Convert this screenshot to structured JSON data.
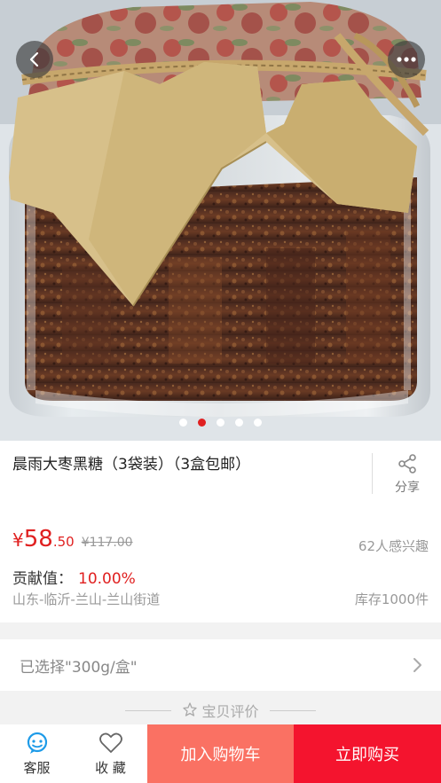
{
  "product": {
    "title": "晨雨大枣黑糖（3袋装）（3盒包邮）",
    "price_currency": "¥",
    "price_integer": "58",
    "price_decimal": ".50",
    "original_price": "¥117.00",
    "interest": "62人感兴趣",
    "contribution_label": "贡献值：",
    "contribution_value": "10.00%",
    "location": "山东-临沂-兰山-兰山街道",
    "stock": "库存1000件"
  },
  "share": {
    "label": "分享"
  },
  "carousel": {
    "count": 5,
    "active_index": 1
  },
  "spec": {
    "selected_text": "已选择\"300g/盒\""
  },
  "reviews": {
    "label": "宝贝评价"
  },
  "bottom_bar": {
    "service_label": "客服",
    "favorite_label": "收 藏",
    "add_to_cart_label": "加入购物车",
    "buy_now_label": "立即购买"
  },
  "colors": {
    "accent": "#e02020",
    "cart": "#fa7163",
    "buy": "#f4142e"
  }
}
